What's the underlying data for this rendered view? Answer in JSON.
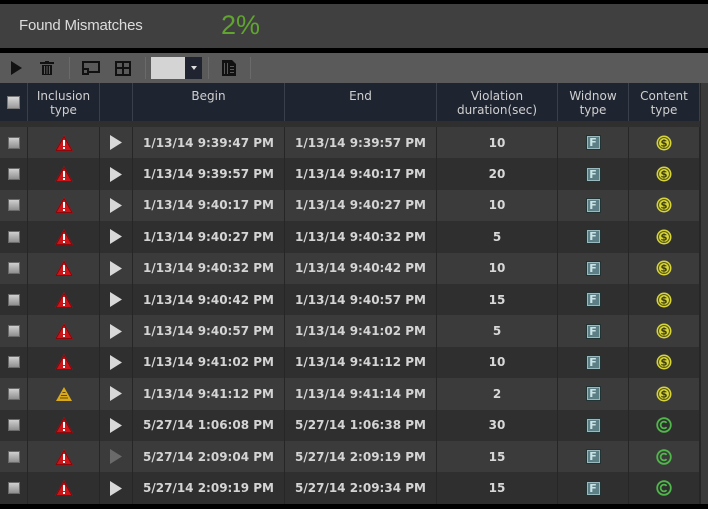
{
  "summary": {
    "label": "Found Mismatches",
    "percent": "2%",
    "percent_color": "#5fa52e"
  },
  "toolbar": {
    "play_icon": "play-icon",
    "delete_icon": "trash-icon",
    "screen_icon": "screen-icon",
    "layout_icon": "grid-layout-icon",
    "dropdown_value": "",
    "export_icon": "export-document-icon"
  },
  "columns": {
    "select": "",
    "inclusion_type": "Inclusion\ntype",
    "play": "",
    "begin": "Begin",
    "end": "End",
    "duration": "Violation\nduration(sec)",
    "window_type": "Widnow\ntype",
    "content_type": "Content\ntype"
  },
  "rows": [
    {
      "inclusion": "red-alert",
      "play_enabled": true,
      "begin": "1/13/14 9:39:47 PM",
      "end": "1/13/14 9:39:57 PM",
      "duration": "10",
      "window": "F",
      "content": "dollar"
    },
    {
      "inclusion": "red-alert",
      "play_enabled": true,
      "begin": "1/13/14 9:39:57 PM",
      "end": "1/13/14 9:40:17 PM",
      "duration": "20",
      "window": "F",
      "content": "dollar"
    },
    {
      "inclusion": "red-alert",
      "play_enabled": true,
      "begin": "1/13/14 9:40:17 PM",
      "end": "1/13/14 9:40:27 PM",
      "duration": "10",
      "window": "F",
      "content": "dollar"
    },
    {
      "inclusion": "red-alert",
      "play_enabled": true,
      "begin": "1/13/14 9:40:27 PM",
      "end": "1/13/14 9:40:32 PM",
      "duration": "5",
      "window": "F",
      "content": "dollar"
    },
    {
      "inclusion": "red-alert",
      "play_enabled": true,
      "begin": "1/13/14 9:40:32 PM",
      "end": "1/13/14 9:40:42 PM",
      "duration": "10",
      "window": "F",
      "content": "dollar"
    },
    {
      "inclusion": "red-alert",
      "play_enabled": true,
      "begin": "1/13/14 9:40:42 PM",
      "end": "1/13/14 9:40:57 PM",
      "duration": "15",
      "window": "F",
      "content": "dollar"
    },
    {
      "inclusion": "red-alert",
      "play_enabled": true,
      "begin": "1/13/14 9:40:57 PM",
      "end": "1/13/14 9:41:02 PM",
      "duration": "5",
      "window": "F",
      "content": "dollar"
    },
    {
      "inclusion": "red-alert",
      "play_enabled": true,
      "begin": "1/13/14 9:41:02 PM",
      "end": "1/13/14 9:41:12 PM",
      "duration": "10",
      "window": "F",
      "content": "dollar"
    },
    {
      "inclusion": "yellow-warning",
      "play_enabled": true,
      "begin": "1/13/14 9:41:12 PM",
      "end": "1/13/14 9:41:14 PM",
      "duration": "2",
      "window": "F",
      "content": "dollar"
    },
    {
      "inclusion": "red-alert",
      "play_enabled": true,
      "begin": "5/27/14 1:06:08 PM",
      "end": "5/27/14 1:06:38 PM",
      "duration": "30",
      "window": "F",
      "content": "copyright"
    },
    {
      "inclusion": "red-alert",
      "play_enabled": false,
      "begin": "5/27/14 2:09:04 PM",
      "end": "5/27/14 2:09:19 PM",
      "duration": "15",
      "window": "F",
      "content": "copyright"
    },
    {
      "inclusion": "red-alert",
      "play_enabled": true,
      "begin": "5/27/14 2:09:19 PM",
      "end": "5/27/14 2:09:34 PM",
      "duration": "15",
      "window": "F",
      "content": "copyright"
    }
  ],
  "colors": {
    "dollar_icon": "#d6d43a",
    "copyright_icon": "#4fb84a",
    "red_alert": "#c8161a",
    "yellow_warning": "#d8a91c"
  }
}
